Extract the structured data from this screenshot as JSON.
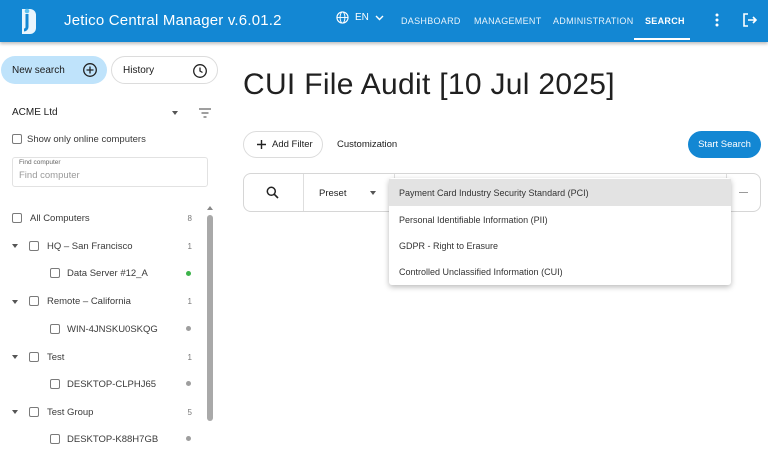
{
  "header": {
    "app_title": "Jetico Central Manager  v.6.01.2",
    "language": "EN",
    "nav": [
      "DASHBOARD",
      "MANAGEMENT",
      "ADMINISTRATION",
      "SEARCH"
    ],
    "active_nav": "SEARCH",
    "brand_color": "#1387d3"
  },
  "sidebar": {
    "new_search_label": "New search",
    "history_label": "History",
    "company": "ACME Ltd",
    "online_only_label": "Show only online computers",
    "find": {
      "label": "Find computer",
      "placeholder": "Find computer"
    },
    "tree": [
      {
        "label": "All Computers",
        "count": "8"
      },
      {
        "label": "HQ – San Francisco",
        "count": "1"
      },
      {
        "label": "Data Server #12_A",
        "status": "online"
      },
      {
        "label": "Remote – California",
        "count": "1"
      },
      {
        "label": "WIN-4JNSKU0SKQG",
        "status": "offline"
      },
      {
        "label": "Test",
        "count": "1"
      },
      {
        "label": "DESKTOP-CLPHJ65",
        "status": "offline"
      },
      {
        "label": "Test Group",
        "count": "5"
      },
      {
        "label": "DESKTOP-K88H7GB",
        "status": "offline"
      }
    ]
  },
  "main": {
    "title": "CUI File Audit [10 Jul 2025]",
    "add_filter_label": "Add Filter",
    "customization_label": "Customization",
    "start_search_label": "Start Search",
    "filter": {
      "type_label": "Preset",
      "options": [
        "Payment Card Industry Security Standard (PCI)",
        "Personal Identifiable Information (PII)",
        "GDPR - Right to Erasure",
        "Controlled Unclassified Information (CUI)"
      ],
      "highlighted_option": "Payment Card Industry Security Standard (PCI)"
    }
  },
  "colors": {
    "online": "#3cb34a",
    "offline": "#9e9e9e"
  }
}
